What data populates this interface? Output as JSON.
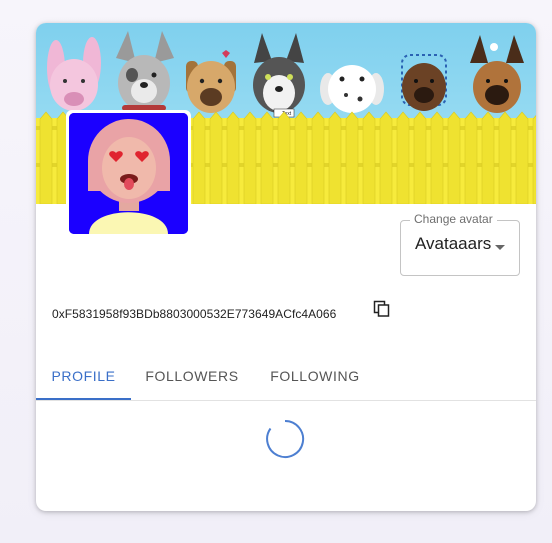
{
  "profile": {
    "avatar_select": {
      "label": "Change avatar",
      "value": "Avataaars"
    },
    "wallet_address": "0xF5831958f93BDb8803000532E773649ACfc4A066",
    "banner": {
      "sign_text": "Text"
    }
  },
  "tabs": [
    {
      "label": "PROFILE",
      "active": true
    },
    {
      "label": "FOLLOWERS",
      "active": false
    },
    {
      "label": "FOLLOWING",
      "active": false
    }
  ],
  "colors": {
    "accent": "#3a6fc8",
    "avatar_background": "#1b00ff",
    "fence": "#f7eb3c",
    "banner_sky": "#8ed7f0"
  },
  "icons": {
    "copy": "copy-icon",
    "dropdown": "chevron-down-icon",
    "loading": "spinner-icon"
  }
}
